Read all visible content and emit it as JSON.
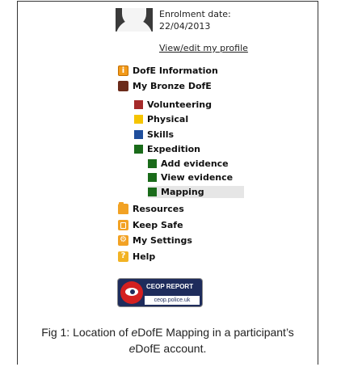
{
  "profile": {
    "enrolment_label": "Enrolment date:",
    "enrolment_date": "22/04/2013",
    "view_edit_link": "View/edit my profile"
  },
  "nav": {
    "dofe_information": "DofE Information",
    "my_bronze_dofe": "My Bronze DofE",
    "volunteering": "Volunteering",
    "physical": "Physical",
    "skills": "Skills",
    "expedition": "Expedition",
    "add_evidence": "Add evidence",
    "view_evidence": "View evidence",
    "mapping": "Mapping",
    "resources": "Resources",
    "keep_safe": "Keep Safe",
    "my_settings": "My Settings",
    "help": "Help"
  },
  "ceop": {
    "title": "CEOP REPORT",
    "url": "ceop.police.uk"
  },
  "caption": {
    "line1_a": "Fig 1: Location of ",
    "line1_e": "e",
    "line1_b": "DofE Mapping in a participant’s",
    "line2_e": "e",
    "line2_b": "DofE account."
  },
  "colors": {
    "volunteering": "#a52a2a",
    "physical": "#f5c400",
    "skills": "#1f4e9c",
    "expedition": "#1a6b1a",
    "selected_bg": "#e6e6e6",
    "ceop_navy": "#1e2c5c",
    "ceop_red": "#d42020"
  },
  "icons": {
    "dofe_information": "info-icon",
    "my_bronze_dofe": "award-icon",
    "resources": "folder-icon",
    "keep_safe": "lock-icon",
    "my_settings": "settings-icon",
    "help": "help-icon"
  }
}
